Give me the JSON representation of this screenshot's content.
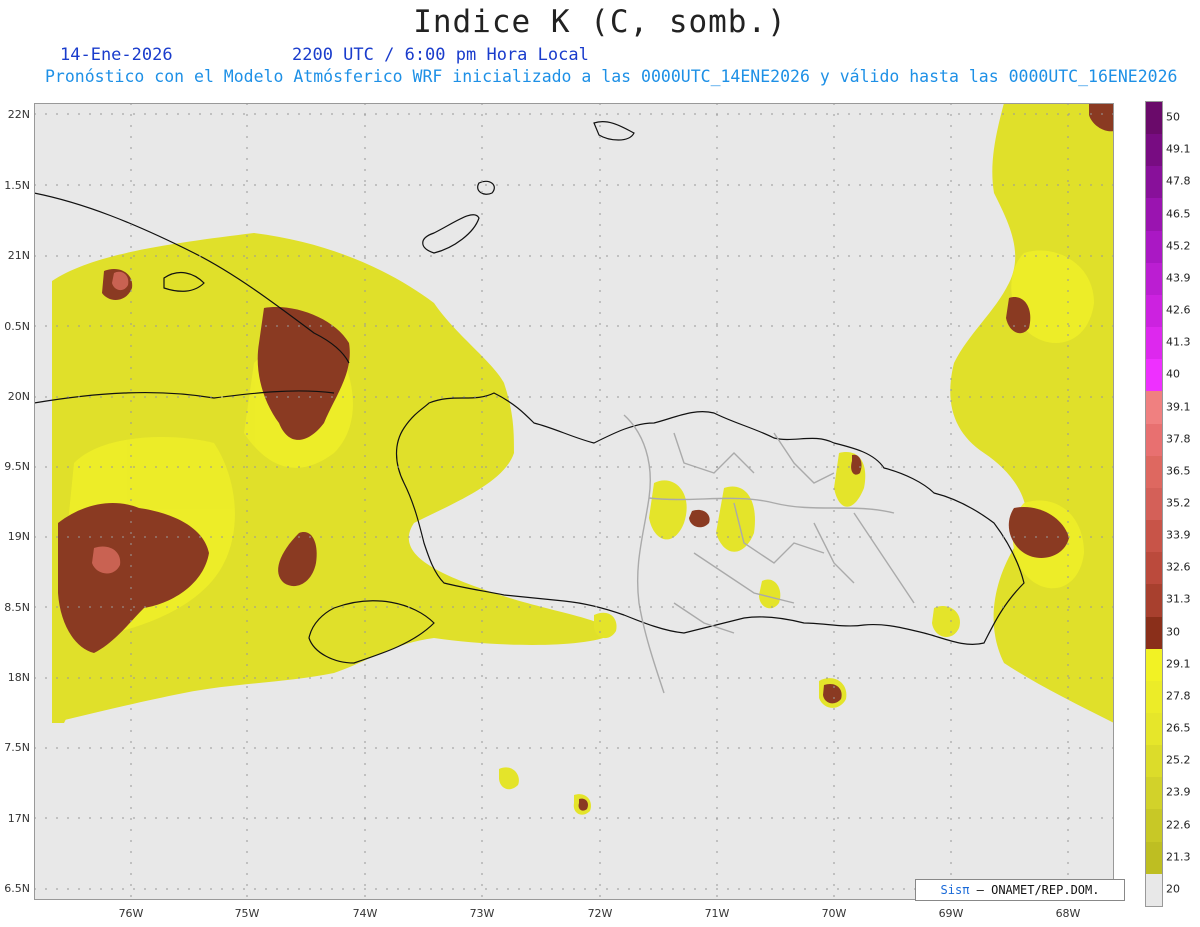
{
  "header": {
    "title": "Indice K (C, somb.)",
    "date": "14-Ene-2026",
    "time": "2200 UTC / 6:00 pm Hora Local",
    "subtitle": "Pronóstico con el Modelo Atmósferico WRF inicializado a las 0000UTC_14ENE2026 y válido hasta las  0000UTC_16ENE2026"
  },
  "map": {
    "lat_labels": [
      "22N",
      "1.5N",
      "21N",
      "0.5N",
      "20N",
      "9.5N",
      "19N",
      "8.5N",
      "18N",
      "7.5N",
      "17N",
      "6.5N"
    ],
    "lon_labels": [
      "76W",
      "75W",
      "74W",
      "73W",
      "72W",
      "71W",
      "70W",
      "69W",
      "68W"
    ],
    "lat_range": [
      16.5,
      22
    ],
    "lon_range": [
      -76.7,
      -67.6
    ]
  },
  "colorbar": {
    "labels": [
      "50",
      "49.1",
      "47.8",
      "46.5",
      "45.2",
      "43.9",
      "42.6",
      "41.3",
      "40",
      "39.1",
      "37.8",
      "36.5",
      "35.2",
      "33.9",
      "32.6",
      "31.3",
      "30",
      "29.1",
      "27.8",
      "26.5",
      "25.2",
      "23.9",
      "22.6",
      "21.3",
      "20"
    ],
    "colors": [
      "#6a0a6a",
      "#780c82",
      "#88109a",
      "#9a14b0",
      "#aa18c4",
      "#bb1ed2",
      "#cc22e0",
      "#dd28ee",
      "#ee30ff",
      "#f08080",
      "#e87070",
      "#de6860",
      "#d46058",
      "#c85448",
      "#bb4a3c",
      "#a8402e",
      "#8a2f1a",
      "#f2f224",
      "#ecec28",
      "#e6e62a",
      "#dcdc2a",
      "#d2d22a",
      "#c8c826",
      "#bebe22",
      "#e8e8e8"
    ]
  },
  "credit": {
    "sis": "Sisπ",
    "text": " – ONAMET/REP.DOM."
  }
}
